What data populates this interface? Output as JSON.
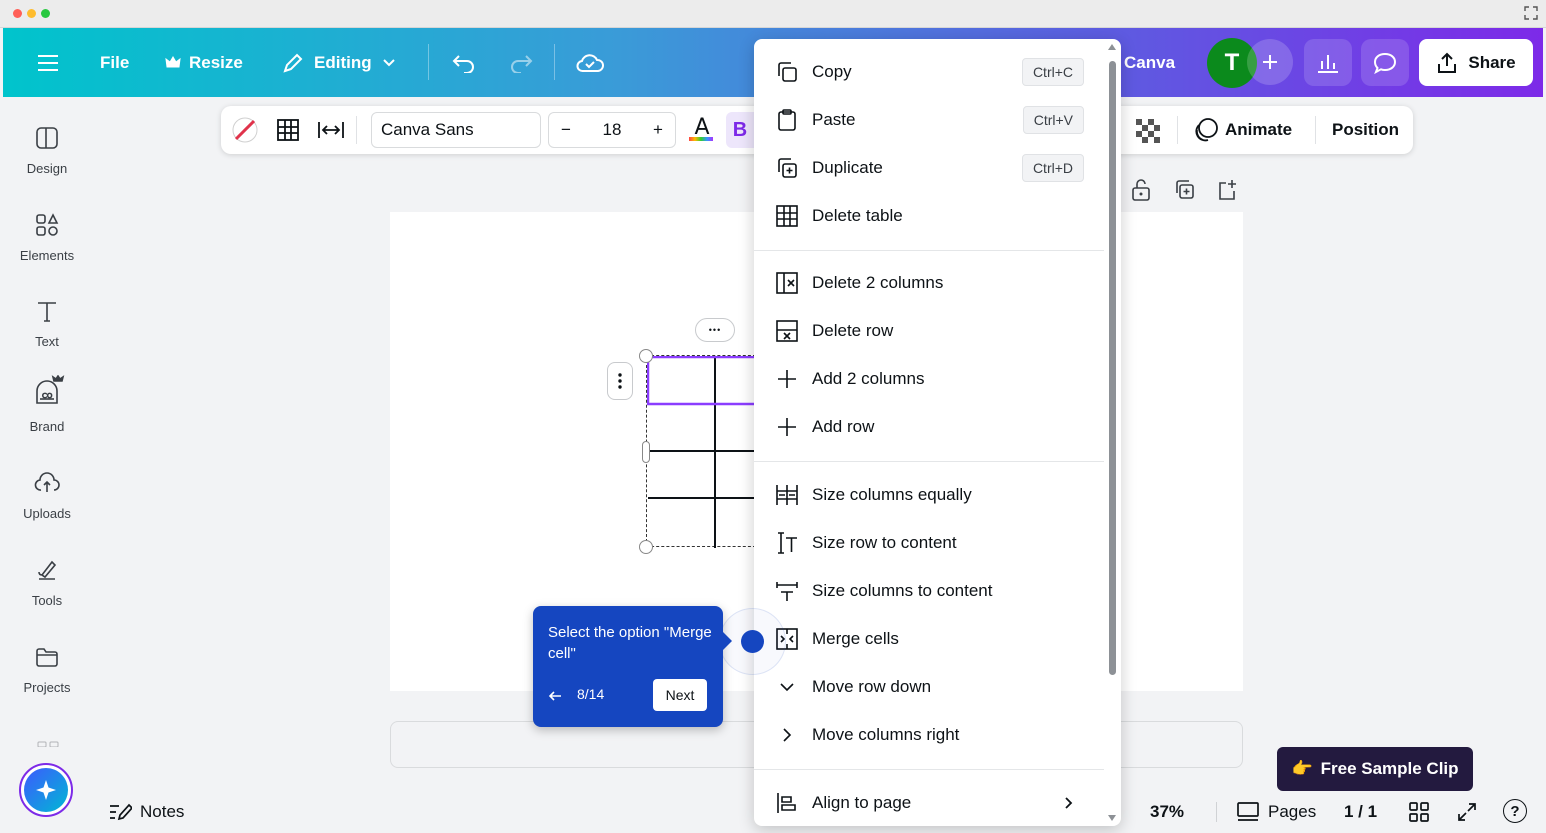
{
  "topbar": {
    "file_label": "File",
    "resize_label": "Resize",
    "editing_label": "Editing",
    "brand_label": "Canva",
    "avatar_initial": "T",
    "share_label": "Share"
  },
  "sidebar": {
    "items": [
      {
        "label": "Design",
        "icon": "layout-icon"
      },
      {
        "label": "Elements",
        "icon": "shapes-icon"
      },
      {
        "label": "Text",
        "icon": "text-icon"
      },
      {
        "label": "Brand",
        "icon": "brand-icon"
      },
      {
        "label": "Uploads",
        "icon": "cloud-upload-icon"
      },
      {
        "label": "Tools",
        "icon": "pen-tool-icon"
      },
      {
        "label": "Projects",
        "icon": "folder-icon"
      }
    ]
  },
  "toolbar": {
    "font_name": "Canva Sans",
    "font_size": "18",
    "minus": "−",
    "plus": "+",
    "bold_label": "B",
    "text_color_letter": "A",
    "animate_label": "Animate",
    "position_label": "Position"
  },
  "canvas": {
    "more_dots": "•••"
  },
  "context_menu": {
    "items": [
      {
        "label": "Copy",
        "shortcut": "Ctrl+C",
        "icon": "copy-icon"
      },
      {
        "label": "Paste",
        "shortcut": "Ctrl+V",
        "icon": "paste-icon"
      },
      {
        "label": "Duplicate",
        "shortcut": "Ctrl+D",
        "icon": "duplicate-icon"
      },
      {
        "label": "Delete table",
        "icon": "table-icon"
      },
      {
        "label": "Delete 2 columns",
        "icon": "delete-column-icon"
      },
      {
        "label": "Delete row",
        "icon": "delete-row-icon"
      },
      {
        "label": "Add 2 columns",
        "icon": "plus-icon"
      },
      {
        "label": "Add row",
        "icon": "plus-icon"
      },
      {
        "label": "Size columns equally",
        "icon": "size-columns-icon"
      },
      {
        "label": "Size row to content",
        "icon": "size-row-icon"
      },
      {
        "label": "Size columns to content",
        "icon": "size-columns-content-icon"
      },
      {
        "label": "Merge cells",
        "icon": "merge-icon"
      },
      {
        "label": "Move row down",
        "icon": "chevron-down-icon"
      },
      {
        "label": "Move columns right",
        "icon": "chevron-right-icon"
      },
      {
        "label": "Align to page",
        "icon": "align-icon"
      }
    ]
  },
  "tooltip": {
    "text": "Select the option \"Merge cell\"",
    "step": "8/14",
    "next_label": "Next"
  },
  "promo": {
    "emoji": "👉",
    "label": "Free Sample Clip"
  },
  "footer": {
    "notes_label": "Notes",
    "zoom": "37%",
    "pages_label": "Pages",
    "page_count": "1 / 1",
    "help": "?"
  },
  "colors": {
    "accent": "#7d2ae8",
    "teal": "#00c4cc",
    "tooltip_blue": "#1546c0",
    "avatar_green": "#0b8a1c"
  }
}
